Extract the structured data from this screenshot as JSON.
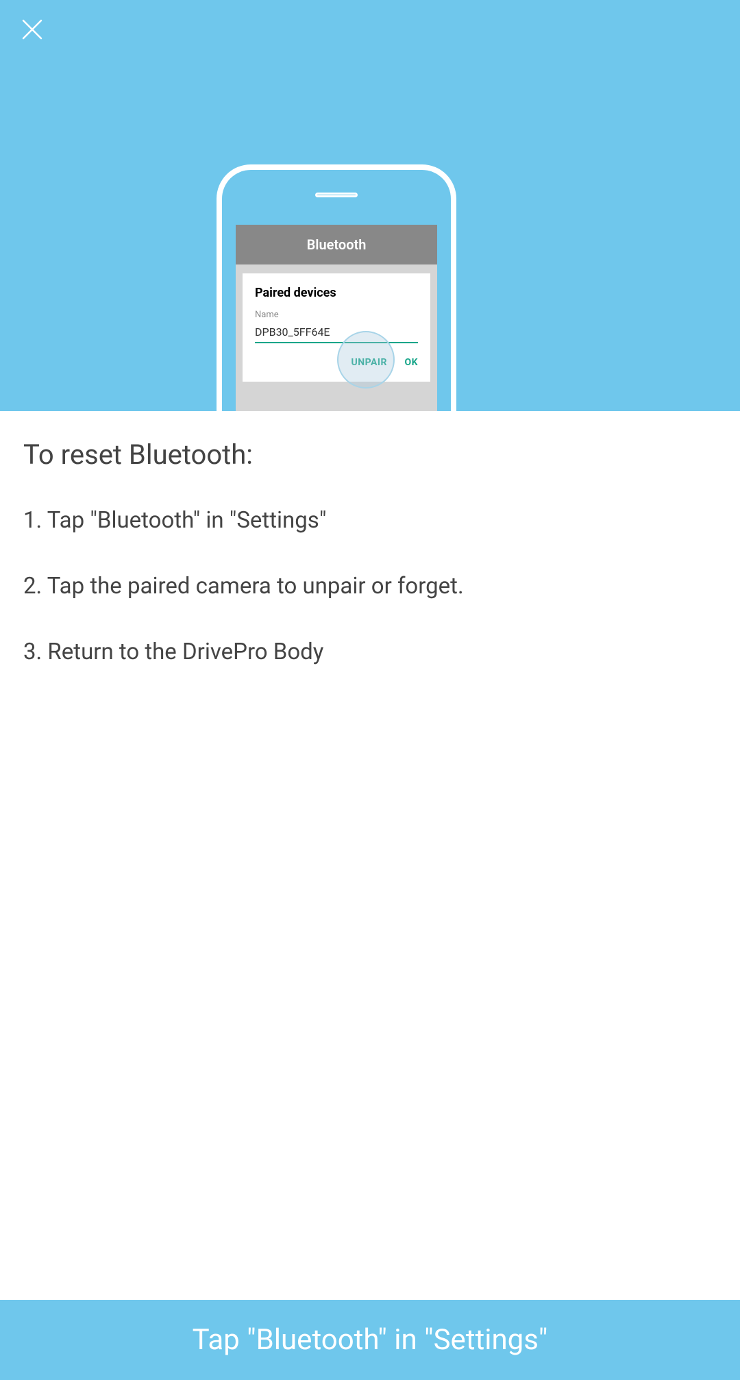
{
  "mockup": {
    "screen_title": "Bluetooth",
    "paired_label": "Paired devices",
    "name_label": "Name",
    "device_name": "DPB30_5FF64E",
    "unpair_label": "UNPAIR",
    "ok_label": "OK"
  },
  "instructions": {
    "title": "To reset Bluetooth:",
    "steps": [
      "1. Tap \"Bluetooth\" in \"Settings\"",
      "2. Tap the paired camera to unpair or forget.",
      "3. Return to the DrivePro Body"
    ]
  },
  "cta": {
    "label": "Tap \"Bluetooth\" in \"Settings\""
  }
}
